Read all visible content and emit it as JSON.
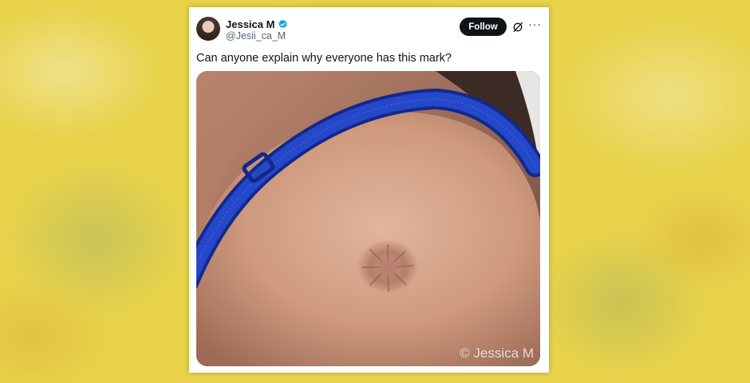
{
  "tweet": {
    "author_name": "Jessica M",
    "author_handle": "@Jesii_ca_M",
    "follow_label": "Follow",
    "text": "Can anyone explain why everyone has this mark?",
    "watermark": "© Jessica M"
  },
  "icons": {
    "verified": "verified-badge-icon",
    "grok": "grok-icon",
    "more": "more-options-icon"
  },
  "colors": {
    "accent": "#1d9bf0",
    "strap": "#1f3fbf",
    "background": "#e8d24a"
  }
}
